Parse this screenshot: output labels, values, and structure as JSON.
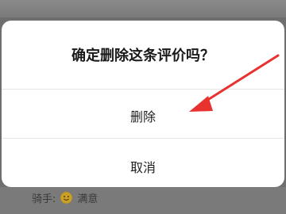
{
  "dialog": {
    "title": "确定删除这条评价吗？",
    "delete_label": "删除",
    "cancel_label": "取消"
  },
  "background": {
    "rider_label": "骑手:",
    "rating_icon": "smiley-icon",
    "rating_label": "满意"
  },
  "annotation": {
    "arrow_color": "#e8322f"
  }
}
